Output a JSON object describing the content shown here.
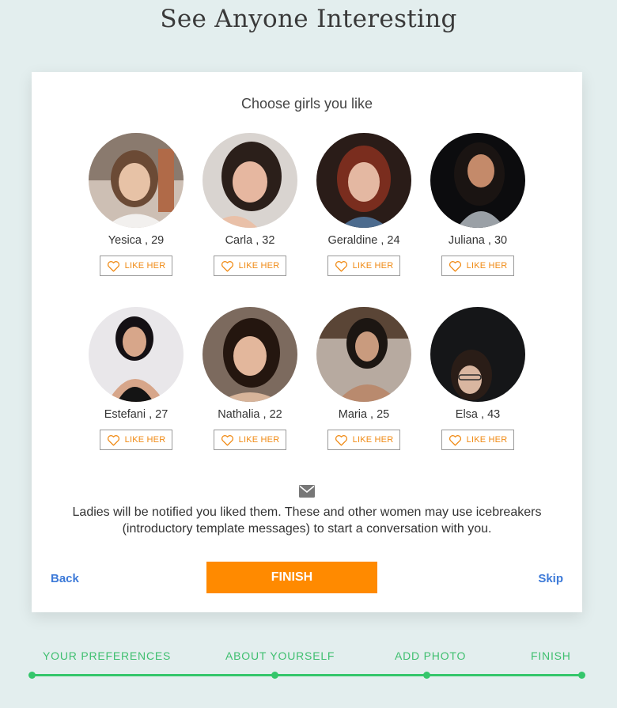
{
  "title": "See Anyone Interesting",
  "card": {
    "heading": "Choose girls you like",
    "girls": [
      {
        "name": "Yesica",
        "age": "29",
        "label": "Yesica , 29",
        "button": "LIKE HER"
      },
      {
        "name": "Carla",
        "age": "32",
        "label": "Carla , 32",
        "button": "LIKE HER"
      },
      {
        "name": "Geraldine",
        "age": "24",
        "label": "Geraldine , 24",
        "button": "LIKE HER"
      },
      {
        "name": "Juliana",
        "age": "30",
        "label": "Juliana , 30",
        "button": "LIKE HER"
      },
      {
        "name": "Estefani",
        "age": "27",
        "label": "Estefani , 27",
        "button": "LIKE HER"
      },
      {
        "name": "Nathalia",
        "age": "22",
        "label": "Nathalia , 22",
        "button": "LIKE HER"
      },
      {
        "name": "Maria",
        "age": "25",
        "label": "Maria , 25",
        "button": "LIKE HER"
      },
      {
        "name": "Elsa",
        "age": "43",
        "label": "Elsa , 43",
        "button": "LIKE HER"
      }
    ],
    "notice": "Ladies will be notified you liked them. These and other women may use icebreakers (introductory template messages) to start a conversation with you.",
    "back_label": "Back",
    "finish_label": "FINISH",
    "skip_label": "Skip"
  },
  "steps": [
    {
      "label": "YOUR PREFERENCES"
    },
    {
      "label": "ABOUT YOURSELF"
    },
    {
      "label": "ADD PHOTO"
    },
    {
      "label": "FINISH"
    }
  ],
  "progress": {
    "completed_fraction": 1.0
  },
  "colors": {
    "accent": "#ff8a00",
    "link": "#3d7ad8",
    "step": "#3fbf6f",
    "background": "#e3eeee"
  },
  "icons": {
    "like": "heart-outline-icon",
    "notice": "envelope-icon"
  }
}
